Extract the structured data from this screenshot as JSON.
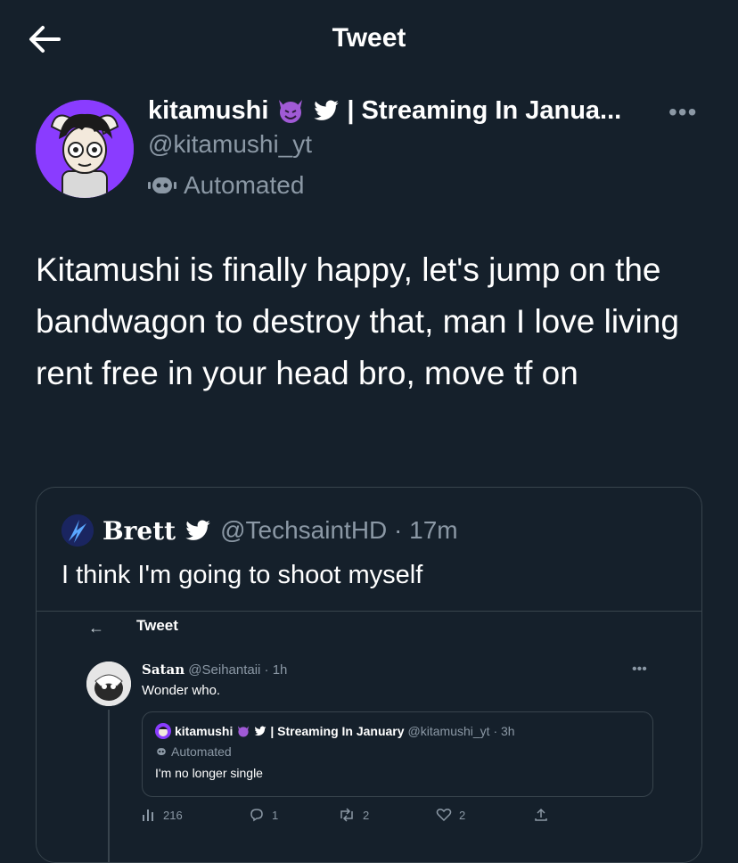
{
  "header": {
    "title": "Tweet"
  },
  "tweet": {
    "author_name": "kitamushi",
    "author_suffix": "| Streaming In Janua...",
    "handle": "@kitamushi_yt",
    "automated_label": "Automated",
    "text": "Kitamushi is finally happy, let's jump on the bandwagon to destroy that, man I love living rent free in your head bro, move tf on"
  },
  "quote": {
    "name": "Brett",
    "handle": "@TechsaintHD · 17m",
    "text": "I think I'm going to shoot myself",
    "screenshot": {
      "title": "Tweet",
      "name": "Satan",
      "handle": "@Seihantaii · 1h",
      "text": "Wonder who.",
      "card": {
        "name": "kitamushi",
        "suffix": "| Streaming In January",
        "handle": "@kitamushi_yt · 3h",
        "automated_label": "Automated",
        "text": "I'm no longer single"
      },
      "actions": {
        "views": "216",
        "replies": "1",
        "retweets": "2",
        "likes": "2"
      }
    }
  },
  "colors": {
    "background": "#15202b",
    "muted": "#8b98a5",
    "border": "#38444d",
    "verified": "#ffffff"
  }
}
